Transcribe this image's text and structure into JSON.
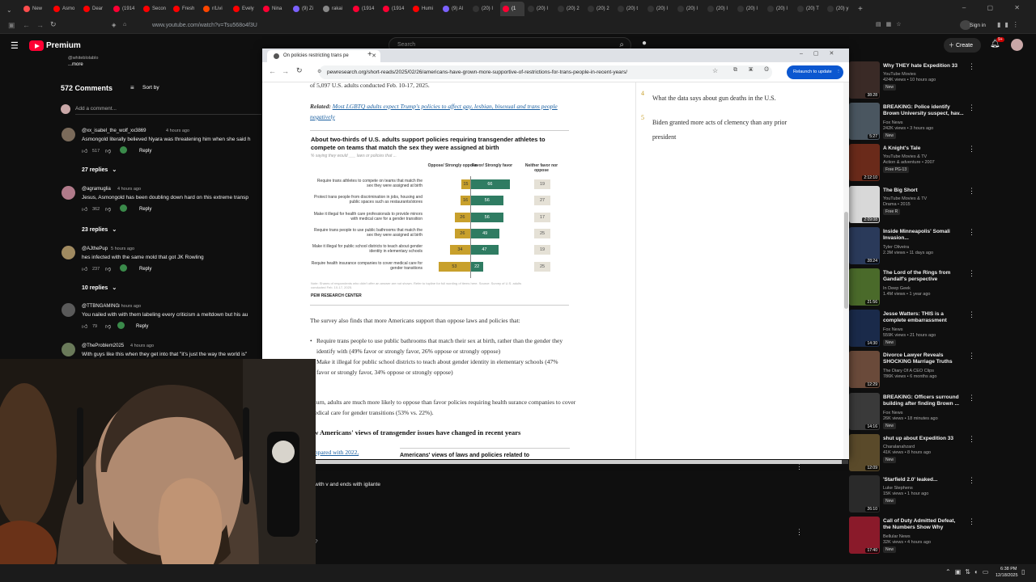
{
  "outer_browser": {
    "tabs": [
      {
        "label": "New",
        "color": "#ff4d4d"
      },
      {
        "label": "Asmo",
        "color": "#ff0000"
      },
      {
        "label": "Dear",
        "color": "#ff0000"
      },
      {
        "label": "(1914",
        "color": "#ff0033"
      },
      {
        "label": "Secon",
        "color": "#ff0000"
      },
      {
        "label": "Fresh",
        "color": "#ff0000"
      },
      {
        "label": "r/Livi",
        "color": "#ff4500"
      },
      {
        "label": "Evely",
        "color": "#ff0000"
      },
      {
        "label": "Nina",
        "color": "#ff0033"
      },
      {
        "label": "(9) Zi",
        "color": "#7b61ff"
      },
      {
        "label": "rakai",
        "color": "#888888"
      },
      {
        "label": "(1914",
        "color": "#ff0033"
      },
      {
        "label": "(1914",
        "color": "#ff0033"
      },
      {
        "label": "Humi",
        "color": "#ff0000"
      },
      {
        "label": "(9) Al",
        "color": "#7b61ff"
      },
      {
        "label": "(20) I",
        "color": "#333333"
      },
      {
        "label": "(1",
        "color": "#ff0033",
        "active": true
      },
      {
        "label": "(20) I",
        "color": "#333333"
      },
      {
        "label": "(20) 2",
        "color": "#333333"
      },
      {
        "label": "(20) 2",
        "color": "#333333"
      },
      {
        "label": "(20) t",
        "color": "#333333"
      },
      {
        "label": "(20) I",
        "color": "#333333"
      },
      {
        "label": "(20) I",
        "color": "#333333"
      },
      {
        "label": "(20) I",
        "color": "#333333"
      },
      {
        "label": "(20) I",
        "color": "#333333"
      },
      {
        "label": "(20) I",
        "color": "#333333"
      },
      {
        "label": "(20) T",
        "color": "#333333"
      },
      {
        "label": "(20) y",
        "color": "#333333"
      }
    ],
    "url": "www.youtube.com/watch?v=Tsu568o4f3U",
    "signin": "Sign in"
  },
  "youtube": {
    "premium": "Premium",
    "search_placeholder": "Search",
    "create": "Create",
    "notif_count": "9+",
    "comments_count": "572 Comments",
    "sort_by": "Sort by",
    "add_comment": "Add a comment...",
    "desc_user": "@whiteblolablo",
    "desc_more": "...more",
    "comments": [
      {
        "user": "@xx_isabel_the_wolf_xx3869",
        "time": "4 hours ago",
        "text": "Asmongold literally believed Nyara was threatening him when she said h",
        "likes": "517",
        "reply": "Reply",
        "replies": "27 replies",
        "avatar": "#7a6a5a"
      },
      {
        "user": "@agramuglia",
        "time": "4 hours ago",
        "text": "Jesus, Asmongold has been doubling down hard on this extreme transp",
        "likes": "362",
        "reply": "Reply",
        "replies": "23 replies",
        "avatar": "#b07a8a"
      },
      {
        "user": "@AJthePup",
        "time": "5 hours ago",
        "text": "hes infected with the same mold that got JK Rowling",
        "likes": "237",
        "reply": "Reply",
        "replies": "10 replies",
        "avatar": "#a08a60"
      },
      {
        "user": "@TTBNGAMING",
        "time": "3 hours ago",
        "text": "You nailed with with them labeling every criticism a meltdown but his au",
        "likes": "79",
        "reply": "Reply",
        "avatar": "#5a5a5a"
      },
      {
        "user": "@TheProblem2025",
        "time": "4 hours ago",
        "text": "With guys like this when they get into that \"it's just the way the world is\"",
        "avatar": "#6a7a5a"
      }
    ],
    "partial_text_1": "with v and ends with igilante",
    "related": [
      {
        "title": "Why THEY hate Expedition 33",
        "channel": "YouTube Movies",
        "views": "424K views • 10 hours ago",
        "badge": "New",
        "dur": "38:28",
        "thumb": "#3a2a26"
      },
      {
        "title": "BREAKING: Police identify Brown University suspect, hav...",
        "channel": "Fox News",
        "views": "242K views • 3 hours ago",
        "badge": "New",
        "dur": "5:27",
        "thumb": "#4a5660"
      },
      {
        "title": "A Knight's Tale",
        "channel": "YouTube Movies & TV",
        "views": "Action & adventure • 2007",
        "badge": "Free  PG-13",
        "dur": "2:12:10",
        "thumb": "#6a2a1a"
      },
      {
        "title": "The Big Short",
        "channel": "YouTube Movies & TV",
        "views": "Drama • 2015",
        "badge": "Free  R",
        "dur": "2:09:08",
        "thumb": "#d8d8d8"
      },
      {
        "title": "Inside Minneapolis' Somali Invasion...",
        "channel": "Tyler Oliveira",
        "views": "2.3M views • 11 days ago",
        "badge": "",
        "dur": "28:24",
        "thumb": "#2a3a5a"
      },
      {
        "title": "The Lord of the Rings from Gandalf's perspective",
        "channel": "In Deep Geek",
        "views": "1.4M views • 1 year ago",
        "badge": "",
        "dur": "21:56",
        "thumb": "#4a6a2a"
      },
      {
        "title": "Jesse Watters: THIS is a complete embarrassment",
        "channel": "Fox News",
        "views": "559K views • 21 hours ago",
        "badge": "New",
        "dur": "14:30",
        "thumb": "#1a2a4a"
      },
      {
        "title": "Divorce Lawyer Reveals SHOCKING Marriage Truths",
        "channel": "The Diary Of A CEO Clips",
        "views": "786K views • 6 months ago",
        "badge": "",
        "dur": "12:29",
        "thumb": "#6a4a3a"
      },
      {
        "title": "BREAKING: Officers surround building after finding Brown ...",
        "channel": "Fox News",
        "views": "26K views • 18 minutes ago",
        "badge": "New",
        "dur": "14:16",
        "thumb": "#3a3a3a"
      },
      {
        "title": "shut up about Expedition 33",
        "channel": "Charalanahzard",
        "views": "41K views • 8 hours ago",
        "badge": "New",
        "dur": "12:09",
        "thumb": "#5a4a2a"
      },
      {
        "title": "'Starfield 2.0' leaked...",
        "channel": "Luke Stephens",
        "views": "15K views • 1 hour ago",
        "badge": "New",
        "dur": "26:10",
        "thumb": "#2a2a2a"
      },
      {
        "title": "Call of Duty Admitted Defeat, the Numbers Show Why",
        "channel": "Bellular News",
        "views": "32K views • 4 hours ago",
        "badge": "New",
        "dur": "17:40",
        "thumb": "#8a1a2a"
      }
    ]
  },
  "inner_browser": {
    "tab_title": "On policies restricting trans pe",
    "url": "pewresearch.org/short-reads/2025/02/26/americans-have-grown-more-supportive-of-restrictions-for-trans-people-in-recent-years/",
    "relaunch": "Relaunch to update"
  },
  "article": {
    "intro_fragment": "of 5,097 U.S. adults conducted Feb. 10-17, 2025.",
    "related_label": "Related:",
    "related_link": "Most LGBTQ adults expect Trump's policies to affect gay, lesbian, bisexual and trans people negatively",
    "para1": "The survey also finds that more Americans support than oppose laws and policies that:",
    "bullet1": "Require trans people to use public bathrooms that match their sex at birth, rather than the gender they identify with (49% favor or strongly favor, 26% oppose or strongly oppose)",
    "bullet2": "Make it illegal for public school districts to teach about gender identity in elementary schools (47% favor or strongly favor, 34% oppose or strongly oppose)",
    "para2": "n turn, adults are much more likely to oppose than favor policies requiring health surance companies to cover medical care for gender transitions (53% vs. 22%).",
    "heading": "ow Americans' views of transgender issues have changed in recent years",
    "compared": "ompared with 2022,",
    "next_chart_title": "Americans' views of laws and policies related to",
    "sidebar": [
      {
        "num": "4",
        "text": "What the data says about gun deaths in the U.S."
      },
      {
        "num": "5",
        "text": "Biden granted more acts of clemency than any prior president"
      }
    ]
  },
  "chart_data": {
    "type": "bar",
    "title": "About two-thirds of U.S. adults support policies requiring transgender athletes to compete on teams that match the sex they were assigned at birth",
    "subtitle": "% saying they would ___ laws or policies that ...",
    "columns": [
      "Oppose/ Strongly oppose",
      "Favor/ Strongly favor",
      "Neither favor nor oppose"
    ],
    "categories": [
      "Require trans athletes to compete on teams that match the sex they were assigned at birth",
      "Protect trans people from discrimination in jobs, housing and public spaces such as restaurants/stores",
      "Make it illegal for health care professionals to provide minors with medical care for a gender transition",
      "Require trans people to use public bathrooms that match the sex they were assigned at birth",
      "Make it illegal for public school districts to teach about gender identity in elementary schools",
      "Require health insurance companies to cover medical care for gender transitions"
    ],
    "series": [
      {
        "name": "Oppose/Strongly oppose",
        "values": [
          15,
          16,
          26,
          26,
          34,
          53
        ],
        "color": "#c8a02c"
      },
      {
        "name": "Favor/Strongly favor",
        "values": [
          66,
          56,
          56,
          49,
          47,
          22
        ],
        "color": "#2f7c62"
      },
      {
        "name": "Neither favor nor oppose",
        "values": [
          19,
          27,
          17,
          25,
          19,
          25
        ],
        "color": "#e5e1d6"
      }
    ],
    "note": "Note: Shares of respondents who didn't offer an answer are not shown. Refer to topline for full wording of items here. Source: Survey of U.S. adults conducted Feb. 10-17, 2025.",
    "source": "PEW RESEARCH CENTER"
  },
  "taskbar": {
    "time": "6:38 PM",
    "date": "12/18/2025"
  }
}
